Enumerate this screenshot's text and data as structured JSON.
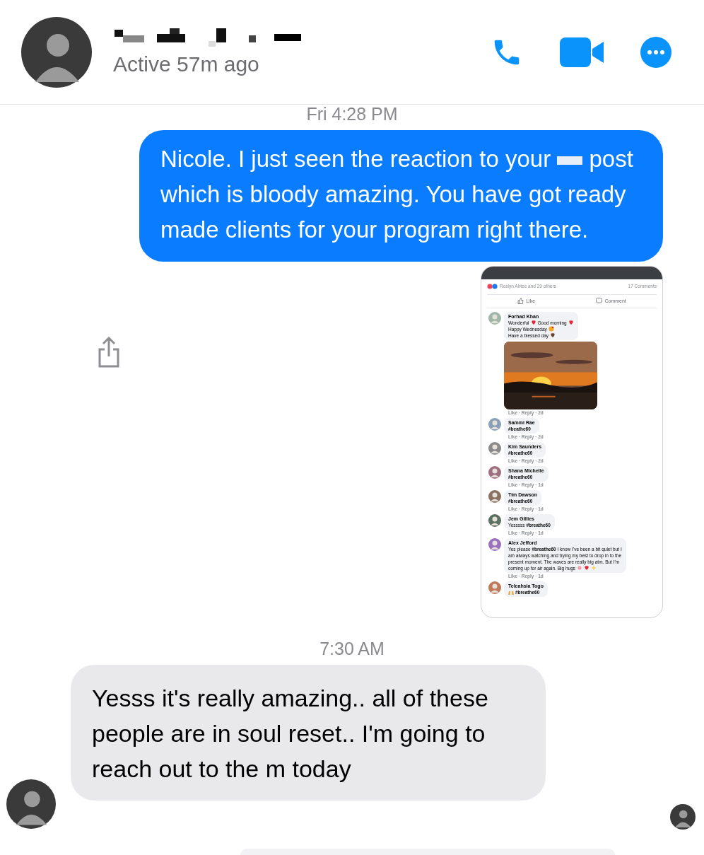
{
  "header": {
    "status": "Active 57m ago"
  },
  "messages": [
    {
      "kind": "timestamp",
      "text": "Fri 4:28 PM"
    },
    {
      "kind": "outgoing",
      "text_parts": [
        "Nicole. I just seen the reaction to your",
        "post which is bloody amazing. You have got ready made clients for your program right there."
      ]
    },
    {
      "kind": "shared_screenshot",
      "reactions": "Roslyn Ahtee and 29 others",
      "comments_count": "17 Comments",
      "actions": [
        "Like",
        "Comment"
      ],
      "comments": [
        {
          "author": "Forhad Khan",
          "lines": [
            [
              {
                "kind": "text",
                "text": "Wonderful "
              },
              {
                "kind": "heart"
              },
              {
                "kind": "text",
                "text": "Good morning "
              },
              {
                "kind": "heart"
              }
            ],
            [
              {
                "kind": "text",
                "text": "Happy Wednesday "
              },
              {
                "kind": "hug"
              }
            ],
            [
              {
                "kind": "text",
                "text": "Have a blessed day "
              },
              {
                "kind": "brown-heart"
              }
            ]
          ],
          "photo": true,
          "meta": "Like · Reply · 2d"
        },
        {
          "author": "Sammi Rae",
          "lines": [
            [
              {
                "kind": "text",
                "text": "**#beathe60**"
              }
            ]
          ],
          "meta": "Like · Reply · 2d"
        },
        {
          "author": "Kim Saunders",
          "lines": [
            [
              {
                "kind": "text",
                "text": "**#breathe60**"
              }
            ]
          ],
          "meta": "Like · Reply · 2d"
        },
        {
          "author": "Shana Michelle",
          "lines": [
            [
              {
                "kind": "text",
                "text": "**#breathe60**"
              }
            ]
          ],
          "meta": "Like · Reply · 1d"
        },
        {
          "author": "Tim Dawson",
          "lines": [
            [
              {
                "kind": "text",
                "text": "**#breathe60**"
              }
            ]
          ],
          "meta": "Like · Reply · 1d"
        },
        {
          "author": "Jem Gillies",
          "lines": [
            [
              {
                "kind": "text",
                "text": "Yesssss **#breathe60**"
              }
            ]
          ],
          "meta": "Like · Reply · 1d"
        },
        {
          "author": "Alex Jefford",
          "lines": [
            [
              {
                "kind": "text",
                "text": "Yes please **#breathe60** I know I've been a bit quiet but I"
              }
            ],
            [
              {
                "kind": "text",
                "text": "am always watching and trying my best to drop in to the"
              }
            ],
            [
              {
                "kind": "text",
                "text": "present moment. The waves are really big atm. But I'm"
              }
            ],
            [
              {
                "kind": "text",
                "text": "coming up for air again. Big hugs"
              },
              {
                "kind": "flower"
              },
              {
                "kind": "heart"
              },
              {
                "kind": "sparkles"
              }
            ]
          ],
          "meta": "Like · Reply · 1d"
        },
        {
          "author": "Teleahsia Togo",
          "lines": [
            [
              {
                "kind": "hands"
              },
              {
                "kind": "text",
                "text": "**#breathe60**"
              }
            ]
          ]
        }
      ]
    },
    {
      "kind": "timestamp",
      "text": "7:30 AM"
    },
    {
      "kind": "incoming",
      "text": "Yesss it's really amazing.. all of these people are in soul reset.. I'm going to reach out to the m today"
    }
  ]
}
